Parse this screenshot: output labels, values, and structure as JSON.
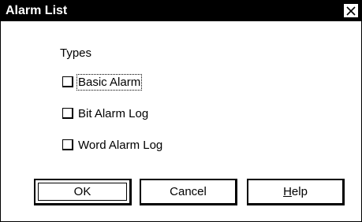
{
  "window": {
    "title": "Alarm List"
  },
  "types": {
    "label": "Types",
    "options": [
      {
        "label": "Basic Alarm",
        "checked": false
      },
      {
        "label": "Bit Alarm Log",
        "checked": false
      },
      {
        "label": "Word Alarm Log",
        "checked": false
      }
    ]
  },
  "buttons": {
    "ok": "OK",
    "cancel": "Cancel",
    "help_mnemonic": "H",
    "help_rest": "elp"
  },
  "colors": {
    "titlebar": "#000000",
    "background": "#ffffff"
  }
}
